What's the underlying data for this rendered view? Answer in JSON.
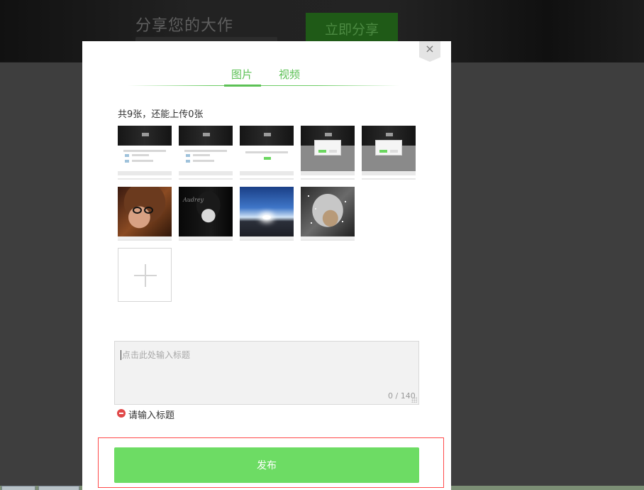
{
  "background_page": {
    "banner_title": "分享您的大作",
    "share_button_label": "立即分享"
  },
  "modal": {
    "close_symbol": "×",
    "tabs": [
      {
        "label": "图片",
        "active": true
      },
      {
        "label": "视频",
        "active": false
      }
    ],
    "upload_count_text": "共9张，还能上传0张",
    "images": [
      {
        "kind": "screenshot",
        "description_icon": "site-screenshot"
      },
      {
        "kind": "screenshot",
        "description_icon": "site-screenshot"
      },
      {
        "kind": "screenshot",
        "description_icon": "site-screenshot"
      },
      {
        "kind": "screenshot-dialog",
        "description_icon": "site-screenshot"
      },
      {
        "kind": "screenshot-dialog",
        "description_icon": "site-screenshot"
      },
      {
        "kind": "photo",
        "description_icon": "photo"
      },
      {
        "kind": "photo",
        "description_icon": "photo"
      },
      {
        "kind": "photo",
        "description_icon": "photo"
      },
      {
        "kind": "photo",
        "description_icon": "photo"
      }
    ],
    "add_icon": "plus-icon",
    "title_input": {
      "placeholder": "点击此处输入标题",
      "value": "",
      "counter": "0 / 140"
    },
    "error_message": "请输入标题",
    "publish_button_label": "发布"
  },
  "colors": {
    "accent_green": "#5cc155",
    "publish_green": "#6ddc64",
    "error_red": "#e04848",
    "highlight_red": "#ff4a4a"
  }
}
